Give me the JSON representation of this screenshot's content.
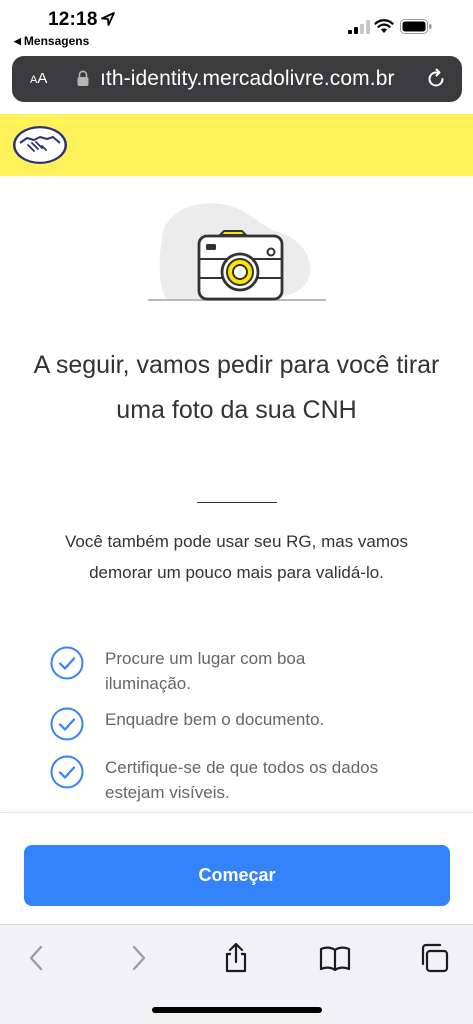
{
  "status_bar": {
    "time": "12:18",
    "back_app": "Mensagens"
  },
  "address_bar": {
    "aa_label_small": "A",
    "aa_label_big": "A",
    "url": "ıth-identity.mercadolivre.com.br"
  },
  "content": {
    "title": "A seguir, vamos pedir para você tirar uma foto da sua CNH",
    "subtitle": "Você também pode usar seu RG, mas vamos demorar um pouco mais para validá-lo.",
    "checklist": [
      "Procure um lugar com boa iluminação.",
      "Enquadre bem o documento.",
      "Certifique-se de que todos os dados estejam visíveis."
    ]
  },
  "actions": {
    "start_label": "Começar"
  },
  "colors": {
    "brand_yellow": "#fff159",
    "primary_blue": "#3483fa",
    "check_blue": "#3483fa"
  },
  "icons": [
    "location-arrow-icon",
    "signal-icon",
    "wifi-icon",
    "battery-icon",
    "lock-icon",
    "reload-icon",
    "handshake-logo",
    "camera-icon",
    "check-circle-icon",
    "back-arrow-icon",
    "forward-arrow-icon",
    "share-icon",
    "bookmarks-icon",
    "tabs-icon"
  ]
}
